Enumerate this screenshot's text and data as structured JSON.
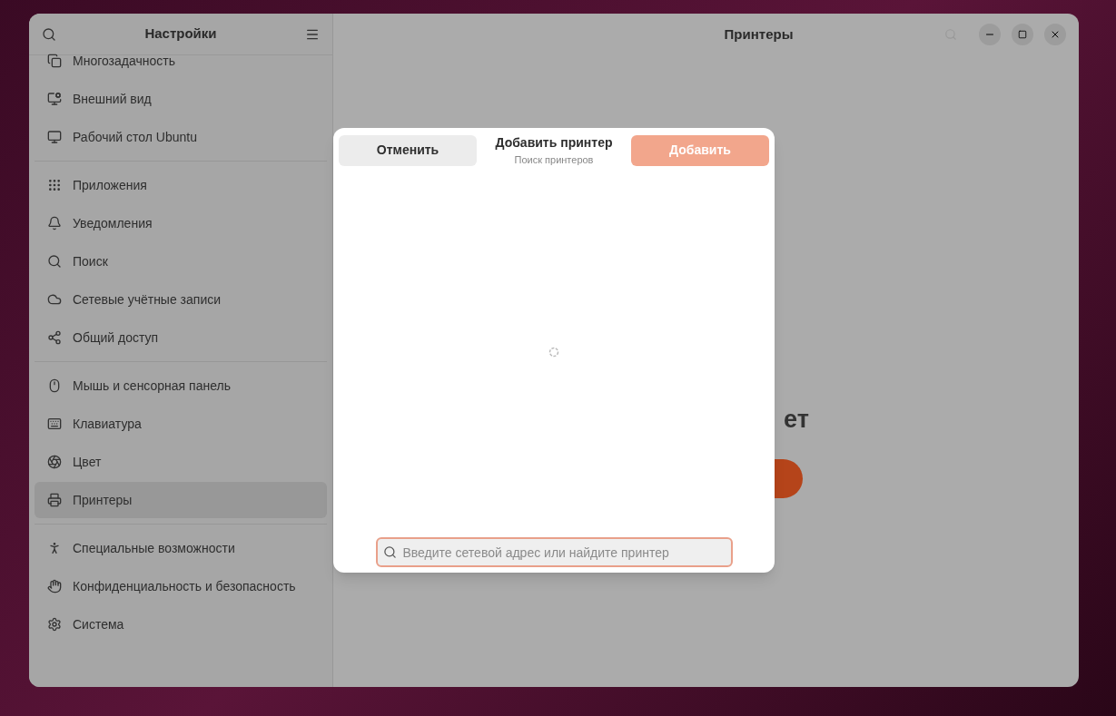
{
  "sidebar": {
    "title": "Настройки",
    "groups": [
      {
        "items": [
          {
            "label": "Многозадачность",
            "selected": false
          },
          {
            "label": "Внешний вид",
            "selected": false
          },
          {
            "label": "Рабочий стол Ubuntu",
            "selected": false
          }
        ]
      },
      {
        "items": [
          {
            "label": "Приложения",
            "selected": false
          },
          {
            "label": "Уведомления",
            "selected": false
          },
          {
            "label": "Поиск",
            "selected": false
          },
          {
            "label": "Сетевые учётные записи",
            "selected": false
          },
          {
            "label": "Общий доступ",
            "selected": false
          }
        ]
      },
      {
        "items": [
          {
            "label": "Мышь и сенсорная панель",
            "selected": false
          },
          {
            "label": "Клавиатура",
            "selected": false
          },
          {
            "label": "Цвет",
            "selected": false
          },
          {
            "label": "Принтеры",
            "selected": true
          }
        ]
      },
      {
        "items": [
          {
            "label": "Специальные возможности",
            "selected": false
          },
          {
            "label": "Конфиденциальность и безопасность",
            "selected": false
          },
          {
            "label": "Система",
            "selected": false
          }
        ]
      }
    ]
  },
  "main": {
    "title": "Принтеры",
    "heading": "ет"
  },
  "dialog": {
    "cancel": "Отменить",
    "title": "Добавить принтер",
    "subtitle": "Поиск принтеров",
    "add": {
      "label": "Добавить",
      "disabled": true
    },
    "search": {
      "placeholder": "Введите сетевой адрес или найдите принтер"
    }
  }
}
